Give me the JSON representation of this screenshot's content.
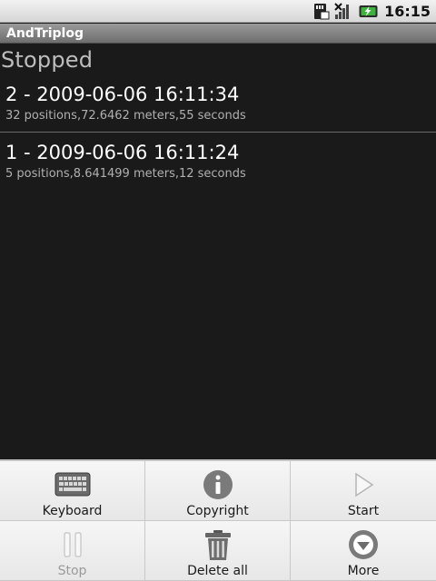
{
  "status_bar": {
    "time": "16:15",
    "icons": [
      "sd-card-icon",
      "no-signal-icon",
      "battery-charging-icon"
    ]
  },
  "app": {
    "title": "AndTriplog"
  },
  "status": {
    "label": "Stopped"
  },
  "trips": [
    {
      "title": "2 - 2009-06-06 16:11:34",
      "details": "32 positions,72.6462 meters,55 seconds"
    },
    {
      "title": "1 - 2009-06-06 16:11:24",
      "details": "5 positions,8.641499 meters,12 seconds"
    }
  ],
  "menu": {
    "keyboard": "Keyboard",
    "copyright": "Copyright",
    "start": "Start",
    "stop": "Stop",
    "delete_all": "Delete all",
    "more": "More"
  },
  "colors": {
    "background": "#1a1a1a",
    "menu_background": "#efefef",
    "disabled_text": "#9a9a9a"
  }
}
